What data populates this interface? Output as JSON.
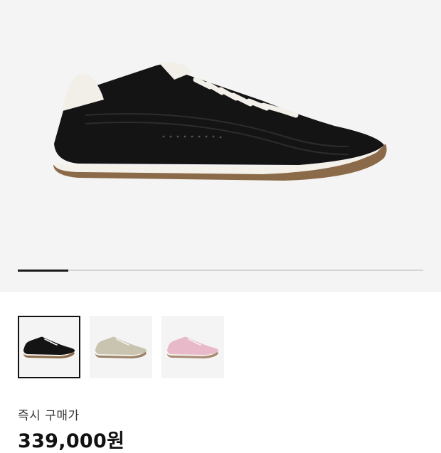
{
  "gallery": {
    "progress": 0.125,
    "images": [
      {
        "variant": "black",
        "color_upper": "#141414",
        "color_sole": "#8a6a48",
        "selected": true
      },
      {
        "variant": "beige",
        "color_upper": "#c9c4b0",
        "color_sole": "#9a8266",
        "selected": false
      },
      {
        "variant": "pink",
        "color_upper": "#e8b9c8",
        "color_sole": "#a88a72",
        "selected": false
      }
    ]
  },
  "purchase": {
    "label": "즉시 구매가",
    "price": "339,000원"
  }
}
